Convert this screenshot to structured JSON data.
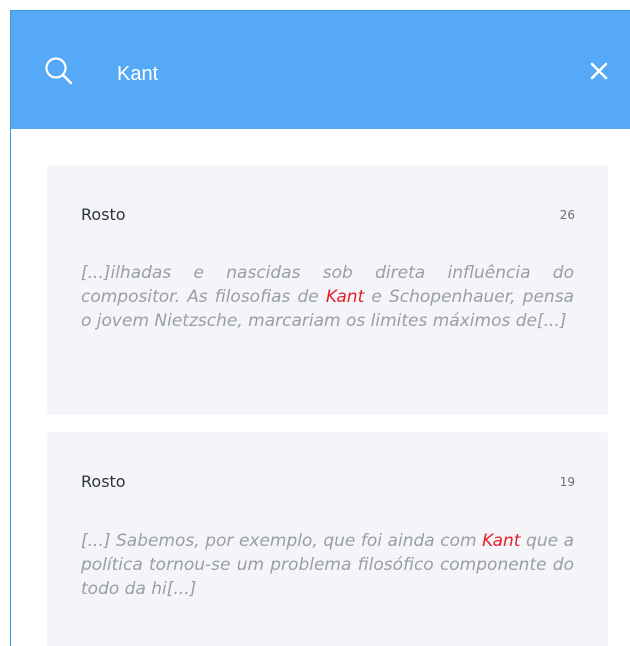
{
  "search": {
    "query": "Kant"
  },
  "results": [
    {
      "title": "Rosto",
      "count": "26",
      "excerpt_before": "[...]ilhadas e nascidas sob direta influência do compositor. As filosofias de ",
      "highlight": "Kant",
      "excerpt_after": " e Schopenhauer, pensa o jovem Nietzsche, marcariam os limites máximos de[...]"
    },
    {
      "title": "Rosto",
      "count": "19",
      "excerpt_before": "[...] Sabemos, por exemplo, que foi ainda com ",
      "highlight": "Kant",
      "excerpt_after": " que a política tornou-se um problema filosófico componente do todo da hi[...]"
    }
  ],
  "colors": {
    "header": "#55a9f7",
    "card": "#f4f5f8",
    "highlight": "#e5202a"
  },
  "icons": {
    "search": "search-icon",
    "close": "close-icon"
  }
}
